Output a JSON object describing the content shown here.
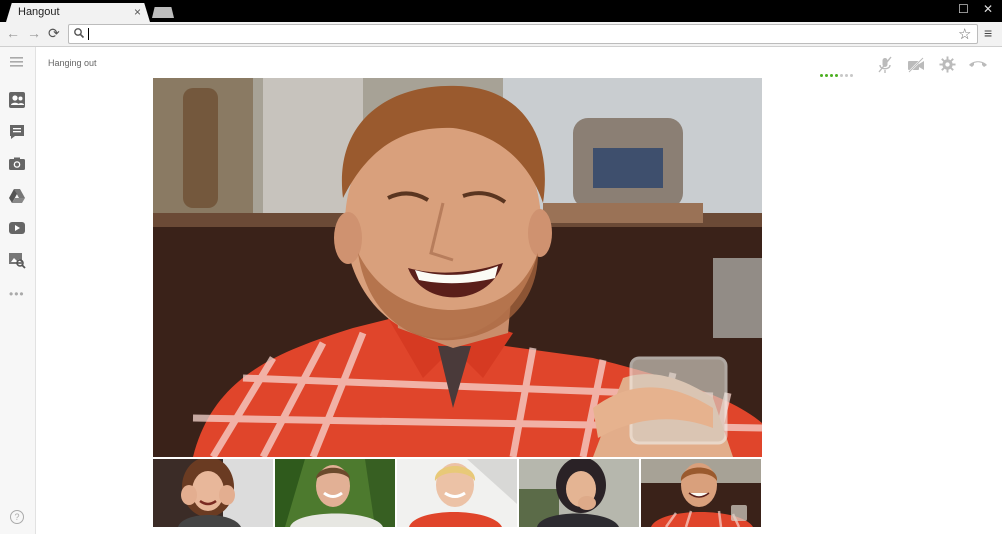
{
  "browser": {
    "tab_title": "Hangout",
    "tab_close": "×",
    "omnibox_value": ""
  },
  "page": {
    "status_title": "Hanging out"
  },
  "sidebar": {
    "items": [
      {
        "icon": "people-icon"
      },
      {
        "icon": "chat-icon"
      },
      {
        "icon": "camera-icon"
      },
      {
        "icon": "drive-icon"
      },
      {
        "icon": "youtube-icon"
      },
      {
        "icon": "screenshare-icon"
      }
    ],
    "more": "•••",
    "help": "?"
  },
  "controls": [
    {
      "icon": "signal-strength-icon"
    },
    {
      "icon": "mute-microphone-icon"
    },
    {
      "icon": "camera-off-icon"
    },
    {
      "icon": "settings-icon"
    },
    {
      "icon": "hang-up-icon"
    }
  ],
  "participants": [
    {
      "name": "participant-1"
    },
    {
      "name": "participant-2"
    },
    {
      "name": "participant-3"
    },
    {
      "name": "participant-4"
    },
    {
      "name": "participant-5"
    }
  ],
  "colors": {
    "signal_on": "#4caf21",
    "signal_off": "#c8c8c8",
    "shirt_red": "#e0452b"
  }
}
